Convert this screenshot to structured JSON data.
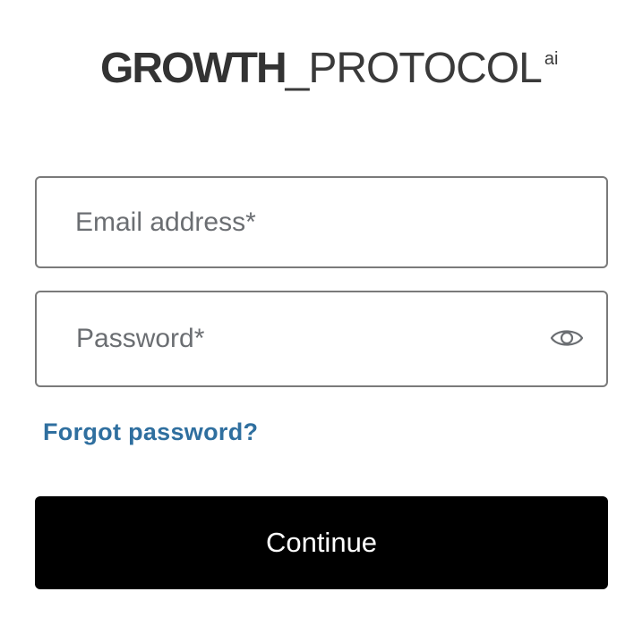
{
  "logo": {
    "bold_text": "GROWTH",
    "light_text": "_PROTOCOL",
    "superscript": "ai"
  },
  "form": {
    "email_placeholder": "Email address*",
    "email_value": "",
    "password_placeholder": "Password*",
    "password_value": "",
    "forgot_label": "Forgot password?",
    "continue_label": "Continue"
  },
  "icons": {
    "password_toggle": "eye-icon"
  },
  "colors": {
    "link": "#2f6f9f",
    "button_bg": "#000000",
    "button_text": "#ffffff",
    "field_border": "#7a7a7a",
    "logo": "#333333"
  }
}
